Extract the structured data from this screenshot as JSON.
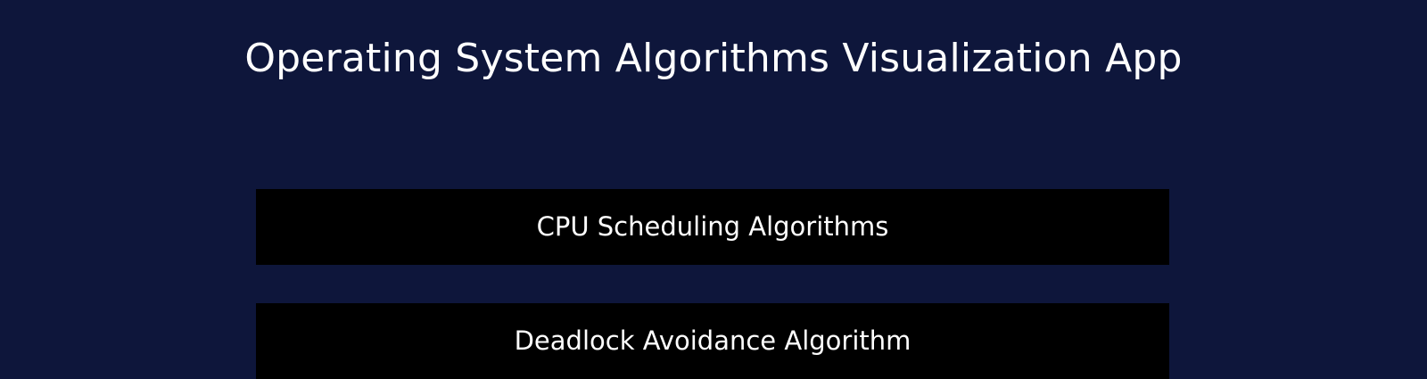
{
  "header": {
    "title": "Operating System Algorithms Visualization App"
  },
  "menu": {
    "items": [
      {
        "label": "CPU Scheduling Algorithms"
      },
      {
        "label": "Deadlock Avoidance Algorithm"
      }
    ]
  },
  "colors": {
    "background": "#0e163b",
    "button_background": "#000000",
    "text": "#ffffff"
  }
}
